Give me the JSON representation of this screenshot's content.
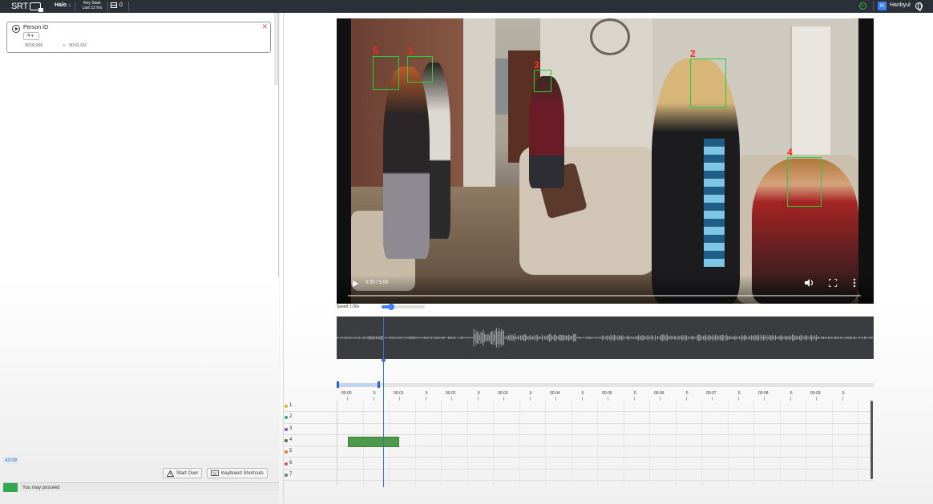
{
  "topbar": {
    "logo_text": "SRT",
    "halo_label": "Halo",
    "halo_caret": "↓",
    "keystats_line1": "Key Stats",
    "keystats_line2": "Last 12 hrs",
    "count": "0",
    "user_initial": "H",
    "user_name": "Hanbyul"
  },
  "left_panel": {
    "card": {
      "title": "Person ID",
      "selected_id": "4",
      "start_time": "00:00.000",
      "end_time": "00:01.011"
    },
    "time_badge": "43:09",
    "buttons": {
      "start_over": "Start Over",
      "keyboard_shortcuts": "Keyboard Shortcuts"
    },
    "proceed_text": "You may proceed"
  },
  "video": {
    "time_display": "0:00 / 5:00",
    "face_labels": [
      "5",
      "1",
      "3",
      "2",
      "4"
    ]
  },
  "speed": {
    "label": "Speed 1.00x",
    "value": 1.0
  },
  "timeline": {
    "ruler": [
      "00:00",
      ".5",
      "00:01",
      ".5",
      "00:02",
      ".5",
      "00:03",
      ".5",
      "00:04",
      ".5",
      "00:05",
      ".5",
      "00:06",
      ".5",
      "00:07",
      ".5",
      "00:08",
      ".5",
      "00:09",
      ".5"
    ],
    "tracks": [
      {
        "label": "1",
        "color": "#e6b400"
      },
      {
        "label": "2",
        "color": "#2ba58a"
      },
      {
        "label": "3",
        "color": "#7a4fd1"
      },
      {
        "label": "4",
        "color": "#2e7d32"
      },
      {
        "label": "5",
        "color": "#e07b1e"
      },
      {
        "label": "6",
        "color": "#d84a86"
      },
      {
        "label": "7",
        "color": "#777777"
      }
    ]
  }
}
